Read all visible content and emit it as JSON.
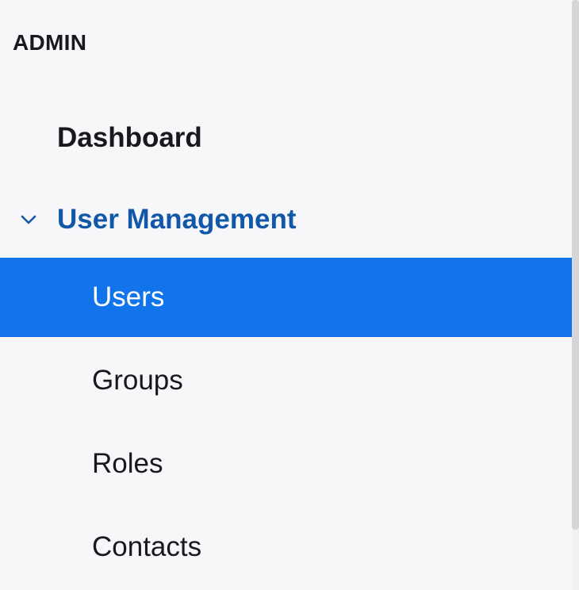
{
  "sidebar": {
    "section_title": "ADMIN",
    "items": [
      {
        "label": "Dashboard"
      },
      {
        "label": "User Management",
        "expanded": true,
        "icon": "chevron-down-icon"
      },
      {
        "label": "Users",
        "selected": true
      },
      {
        "label": "Groups"
      },
      {
        "label": "Roles"
      },
      {
        "label": "Contacts"
      }
    ]
  },
  "colors": {
    "background": "#f7f7f9",
    "text": "#17191d",
    "accent_text": "#1158a8",
    "selected_background": "#1174ea",
    "selected_text": "#ffffff",
    "scrollbar_thumb": "#d6d6d9"
  }
}
